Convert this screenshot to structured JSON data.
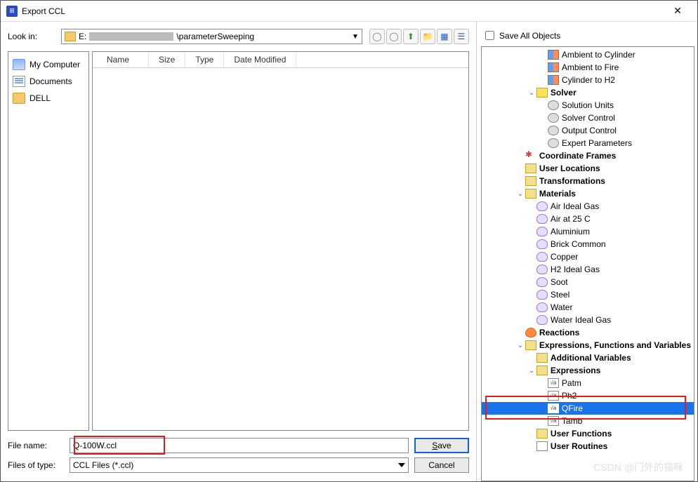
{
  "window": {
    "title": "Export CCL"
  },
  "lookin": {
    "label": "Look in:",
    "drive": "E:",
    "suffix": "\\parameterSweeping"
  },
  "places": [
    {
      "label": "My Computer",
      "icon": "pc"
    },
    {
      "label": "Documents",
      "icon": "doc"
    },
    {
      "label": "DELL",
      "icon": "user"
    }
  ],
  "columns": [
    "Name",
    "Size",
    "Type",
    "Date Modified"
  ],
  "filename": {
    "label": "File name:",
    "value": "Q-100W.ccl"
  },
  "filetype": {
    "label": "Files of type:",
    "value": "CCL Files (*.ccl)"
  },
  "buttons": {
    "save": "Save",
    "cancel": "Cancel"
  },
  "saveall": {
    "label": "Save All Objects"
  },
  "tree": [
    {
      "depth": 5,
      "exp": "",
      "icon": "interf",
      "label": "Ambient to Cylinder"
    },
    {
      "depth": 5,
      "exp": "",
      "icon": "interf",
      "label": "Ambient to Fire"
    },
    {
      "depth": 5,
      "exp": "",
      "icon": "interf",
      "label": "Cylinder to H2"
    },
    {
      "depth": 4,
      "exp": "v",
      "icon": "sol",
      "label": "Solver",
      "bold": true
    },
    {
      "depth": 5,
      "exp": "",
      "icon": "gear",
      "label": "Solution Units"
    },
    {
      "depth": 5,
      "exp": "",
      "icon": "gear",
      "label": "Solver Control"
    },
    {
      "depth": 5,
      "exp": "",
      "icon": "gear",
      "label": "Output Control"
    },
    {
      "depth": 5,
      "exp": "",
      "icon": "gear",
      "label": "Expert Parameters"
    },
    {
      "depth": 3,
      "exp": "",
      "icon": "coord",
      "label": "Coordinate Frames",
      "bold": true
    },
    {
      "depth": 3,
      "exp": "",
      "icon": "box",
      "label": "User Locations",
      "bold": true
    },
    {
      "depth": 3,
      "exp": "",
      "icon": "box",
      "label": "Transformations",
      "bold": true
    },
    {
      "depth": 3,
      "exp": "v",
      "icon": "box",
      "label": "Materials",
      "bold": true
    },
    {
      "depth": 4,
      "exp": "",
      "icon": "flask",
      "label": "Air Ideal Gas"
    },
    {
      "depth": 4,
      "exp": "",
      "icon": "flask",
      "label": "Air at 25 C"
    },
    {
      "depth": 4,
      "exp": "",
      "icon": "flask",
      "label": "Aluminium"
    },
    {
      "depth": 4,
      "exp": "",
      "icon": "flask",
      "label": "Brick Common"
    },
    {
      "depth": 4,
      "exp": "",
      "icon": "flask",
      "label": "Copper"
    },
    {
      "depth": 4,
      "exp": "",
      "icon": "flask",
      "label": "H2 Ideal Gas"
    },
    {
      "depth": 4,
      "exp": "",
      "icon": "flask",
      "label": "Soot"
    },
    {
      "depth": 4,
      "exp": "",
      "icon": "flask",
      "label": "Steel"
    },
    {
      "depth": 4,
      "exp": "",
      "icon": "flask",
      "label": "Water"
    },
    {
      "depth": 4,
      "exp": "",
      "icon": "flask",
      "label": "Water Ideal Gas"
    },
    {
      "depth": 3,
      "exp": "",
      "icon": "fire",
      "label": "Reactions",
      "bold": true
    },
    {
      "depth": 3,
      "exp": "v",
      "icon": "box",
      "label": "Expressions, Functions and Variables",
      "bold": true
    },
    {
      "depth": 4,
      "exp": "",
      "icon": "box",
      "label": "Additional Variables",
      "bold": true
    },
    {
      "depth": 4,
      "exp": "v",
      "icon": "box",
      "label": "Expressions",
      "bold": true
    },
    {
      "depth": 5,
      "exp": "",
      "icon": "fx",
      "label": "Patm"
    },
    {
      "depth": 5,
      "exp": "",
      "icon": "fx",
      "label": "Ph2"
    },
    {
      "depth": 5,
      "exp": "",
      "icon": "fx",
      "label": "QFire",
      "selected": true
    },
    {
      "depth": 5,
      "exp": "",
      "icon": "fx",
      "label": "Tamb"
    },
    {
      "depth": 4,
      "exp": "",
      "icon": "box",
      "label": "User Functions",
      "bold": true
    },
    {
      "depth": 4,
      "exp": "",
      "icon": "sub",
      "label": "User Routines",
      "bold": true
    }
  ],
  "watermark": "CSDN @门外的猫咪"
}
